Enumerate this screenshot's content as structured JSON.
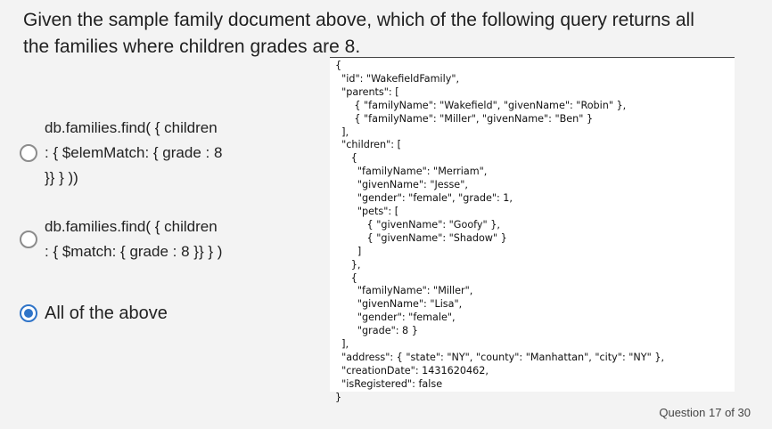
{
  "question": {
    "line1": "Given the sample family document above, which of the following query returns all",
    "line2": "the families where children grades are 8."
  },
  "options": [
    {
      "lines": [
        "db.families.find( { children",
        ": { $elemMatch: { grade : 8",
        "}} } ))"
      ],
      "selected": false
    },
    {
      "lines": [
        "db.families.find( { children",
        ": { $match: { grade : 8 }} } )"
      ],
      "selected": false
    },
    {
      "lines": [
        "All of the above"
      ],
      "selected": true
    }
  ],
  "document": [
    "{",
    "  \"id\": \"WakefieldFamily\",",
    "  \"parents\": [",
    "      { \"familyName\": \"Wakefield\", \"givenName\": \"Robin\" },",
    "      { \"familyName\": \"Miller\", \"givenName\": \"Ben\" }",
    "  ],",
    "  \"children\": [",
    "     {",
    "       \"familyName\": \"Merriam\",",
    "       \"givenName\": \"Jesse\",",
    "       \"gender\": \"female\", \"grade\": 1,",
    "       \"pets\": [",
    "          { \"givenName\": \"Goofy\" },",
    "          { \"givenName\": \"Shadow\" }",
    "       ]",
    "     },",
    "     {",
    "       \"familyName\": \"Miller\",",
    "       \"givenName\": \"Lisa\",",
    "       \"gender\": \"female\",",
    "       \"grade\": 8 }",
    "  ],",
    "  \"address\": { \"state\": \"NY\", \"county\": \"Manhattan\", \"city\": \"NY\" },",
    "  \"creationDate\": 1431620462,",
    "  \"isRegistered\": false",
    "}"
  ],
  "footer": "Question 17 of 30",
  "colors": {
    "accent": "#2f74c8",
    "background": "#f3f3f3"
  }
}
